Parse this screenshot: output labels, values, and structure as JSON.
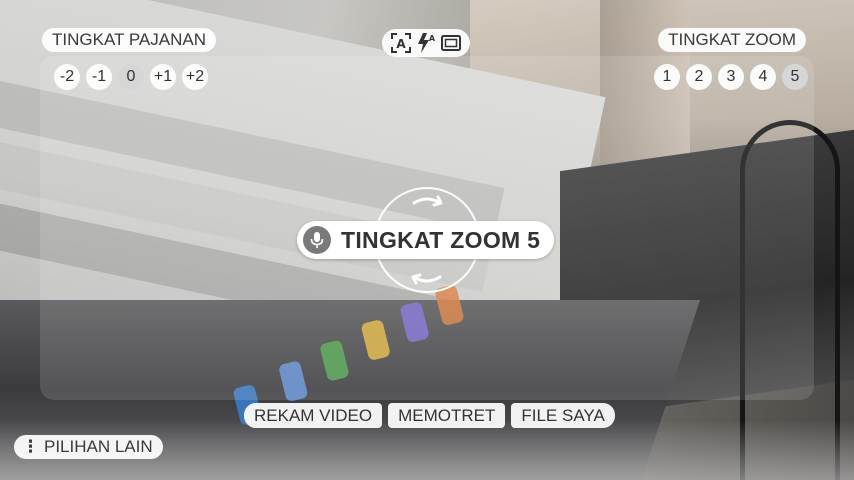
{
  "exposure": {
    "label": "TINGKAT PAJANAN",
    "levels": [
      "-2",
      "-1",
      "0",
      "+1",
      "+2"
    ],
    "selected": "0"
  },
  "zoom": {
    "label": "TINGKAT ZOOM",
    "levels": [
      "1",
      "2",
      "3",
      "4",
      "5"
    ],
    "selected": "5"
  },
  "mode_icons": [
    "auto-scene-icon",
    "flash-auto-icon",
    "aspect-ratio-icon"
  ],
  "toast": {
    "text": "TINGKAT ZOOM 5",
    "icon": "microphone-icon"
  },
  "bottom_actions": {
    "record_video": "REKAM VIDEO",
    "take_photo": "MEMOTRET",
    "my_files": "FILE SAYA"
  },
  "more_options": {
    "icon": "more-vertical-icon",
    "label": "PILIHAN LAIN"
  },
  "colors": {
    "overlay_pill": "#ffffff",
    "text": "#333333",
    "mic_badge": "#7a7a7a"
  }
}
